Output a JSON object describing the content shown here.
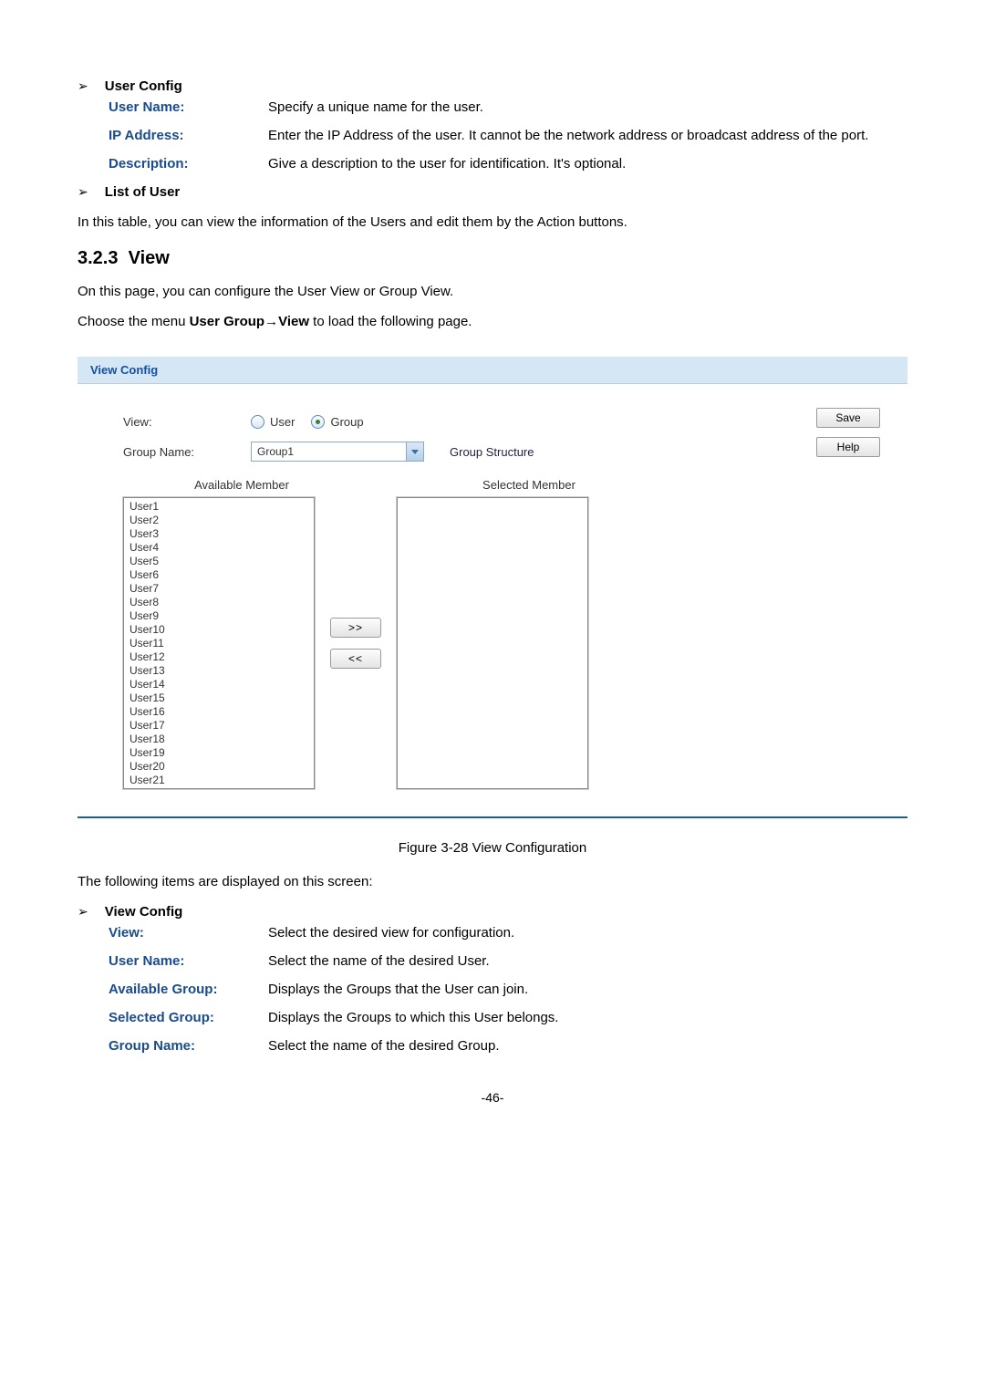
{
  "section1": {
    "heading": "User Config",
    "defs": [
      {
        "label": "User Name:",
        "value": "Specify a unique name for the user."
      },
      {
        "label": "IP Address:",
        "value": "Enter the IP Address of the user. It cannot be the network address or broadcast address of the port."
      },
      {
        "label": "Description:",
        "value": "Give a description to the user for identification. It's optional."
      }
    ]
  },
  "section2": {
    "heading": "List of User",
    "para": "In this table, you can view the information of the Users and edit them by the Action buttons."
  },
  "heading_number": "3.2.3",
  "heading_text": "View",
  "intro1": "On this page, you can configure the User View or Group View.",
  "intro2_prefix": "Choose the menu ",
  "intro2_menu": "User Group→View",
  "intro2_suffix": " to load the following page.",
  "panel": {
    "title": "View Config",
    "view_label": "View:",
    "radio_user": "User",
    "radio_group": "Group",
    "group_name_label": "Group Name:",
    "group_name_value": "Group1",
    "group_structure": "Group Structure",
    "save": "Save",
    "help": "Help",
    "available_header": "Available Member",
    "selected_header": "Selected Member",
    "move_right": ">>",
    "move_left": "<<",
    "available_members": [
      "User1",
      "User2",
      "User3",
      "User4",
      "User5",
      "User6",
      "User7",
      "User8",
      "User9",
      "User10",
      "User11",
      "User12",
      "User13",
      "User14",
      "User15",
      "User16",
      "User17",
      "User18",
      "User19",
      "User20",
      "User21"
    ]
  },
  "figure_caption": "Figure 3-28 View Configuration",
  "after_fig": "The following items are displayed on this screen:",
  "section3": {
    "heading": "View Config",
    "defs": [
      {
        "label": "View:",
        "value": "Select the desired view for configuration."
      },
      {
        "label": "User Name:",
        "value": "Select the name of the desired User."
      },
      {
        "label": "Available Group:",
        "value": "Displays the Groups that the User can join."
      },
      {
        "label": "Selected Group:",
        "value": "Displays the Groups to which this User belongs."
      },
      {
        "label": "Group Name:",
        "value": "Select the name of the desired Group."
      }
    ]
  },
  "page_number": "-46-"
}
